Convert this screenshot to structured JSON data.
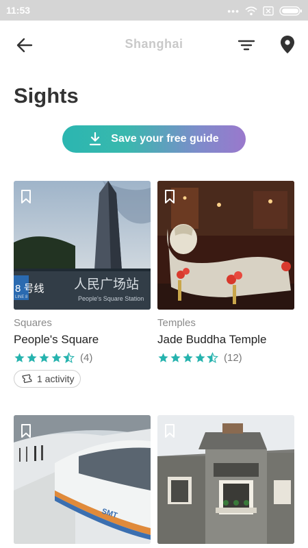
{
  "status_bar": {
    "time": "11:53"
  },
  "app_bar": {
    "title": "Shanghai"
  },
  "heading": "Sights",
  "save_guide": {
    "label": "Save your free guide"
  },
  "colors": {
    "accent": "#2bb6b0",
    "gradient_end": "#9a78cc",
    "star": "#26b3ae"
  },
  "cards": [
    {
      "category": "Squares",
      "title": "People's Square",
      "rating": 4.5,
      "reviews": "(4)",
      "activity": "1 activity"
    },
    {
      "category": "Temples",
      "title": "Jade Buddha Temple",
      "rating": 4.5,
      "reviews": "(12)"
    },
    {
      "category": "",
      "title": ""
    },
    {
      "category": "",
      "title": ""
    }
  ],
  "photo_text": {
    "station_line": "8 号线",
    "station_line_en": "LINE 8",
    "station_cn": "人民广场站",
    "station_en": "People's Square Station",
    "train_logo": "SMT"
  }
}
